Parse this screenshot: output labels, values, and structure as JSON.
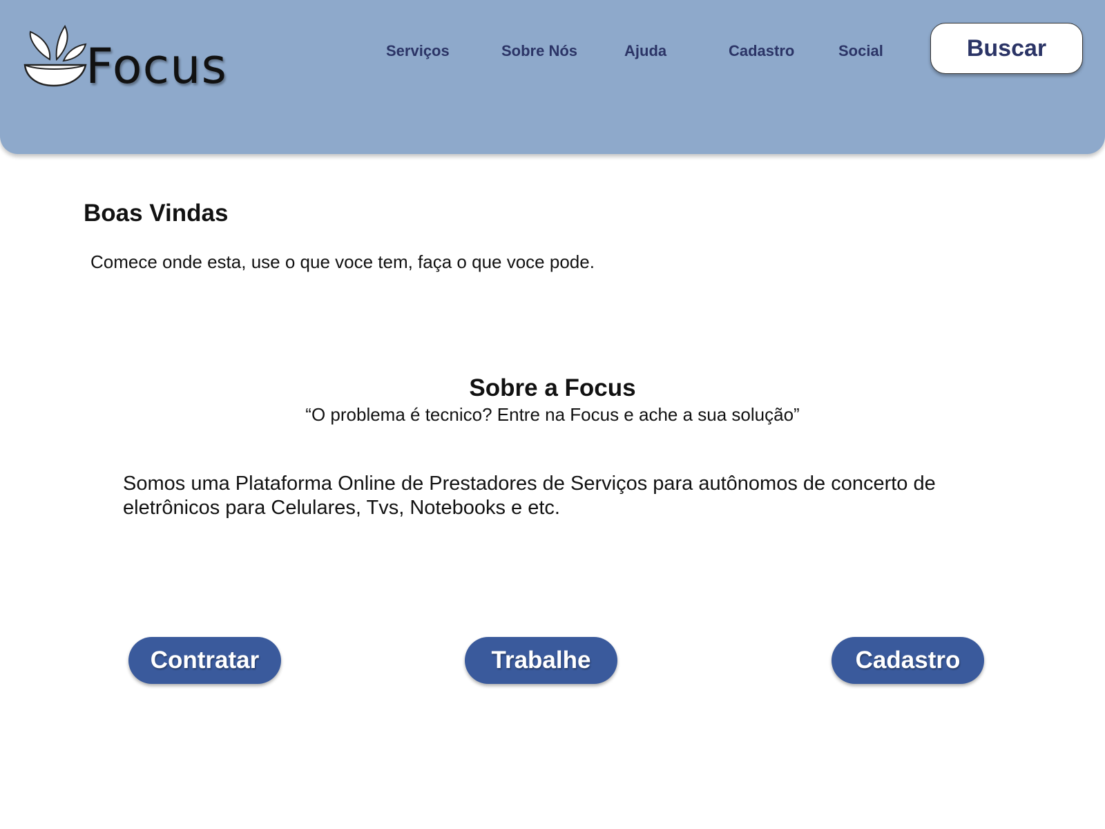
{
  "brand": {
    "name": "Focus",
    "logo_icon": "leaf-bowl-icon"
  },
  "nav": {
    "items": [
      {
        "label": "Serviços"
      },
      {
        "label": "Sobre Nós"
      },
      {
        "label": "Ajuda"
      },
      {
        "label": "Cadastro"
      },
      {
        "label": "Social"
      }
    ],
    "search_label": "Buscar"
  },
  "welcome": {
    "title": "Boas Vindas",
    "text": "Comece onde esta, use o que voce tem, faça o que voce pode."
  },
  "about": {
    "title": "Sobre a Focus",
    "quote": "“O problema é tecnico? Entre na Focus e ache a sua solução”",
    "description": "Somos uma Plataforma Online de Prestadores de Serviços para autônomos de concerto de eletrônicos para Celulares, Tvs, Notebooks e etc."
  },
  "actions": {
    "hire_label": "Contratar",
    "work_label": "Trabalhe",
    "signup_label": "Cadastro"
  },
  "colors": {
    "header_bg": "#8ea9cb",
    "nav_text": "#2b3466",
    "button_bg": "#3a5a9c"
  }
}
